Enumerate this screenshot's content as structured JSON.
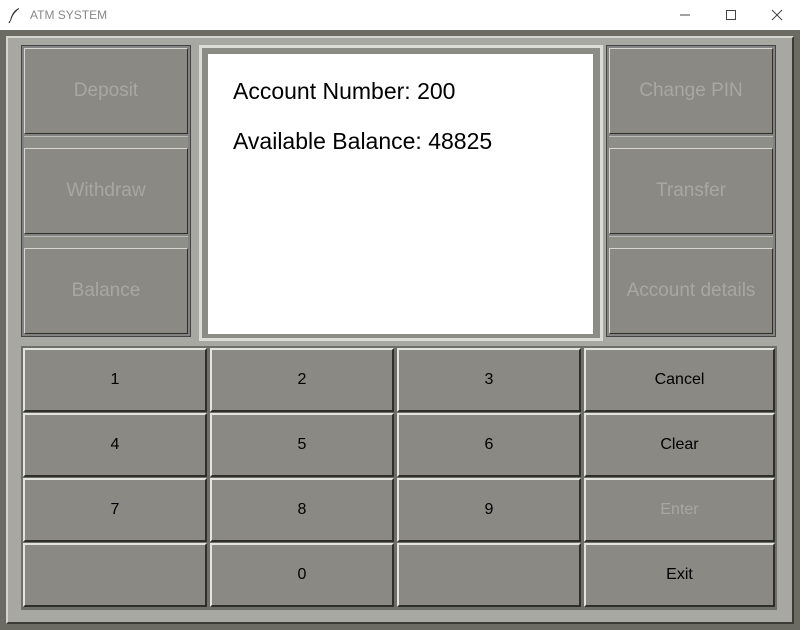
{
  "window": {
    "title": "ATM SYSTEM"
  },
  "icons": {
    "app": "feather-icon",
    "minimize": "minimize-icon",
    "maximize": "maximize-icon",
    "close": "close-icon"
  },
  "colors": {
    "frame": "#6b6b64",
    "button_face": "#8a8983",
    "disabled_text": "#a8a8a2",
    "screen": "#ffffff"
  },
  "left_buttons": [
    {
      "label": "Deposit",
      "enabled": false
    },
    {
      "label": "Withdraw",
      "enabled": false
    },
    {
      "label": "Balance",
      "enabled": false
    }
  ],
  "right_buttons": [
    {
      "label": "Change PIN",
      "enabled": false
    },
    {
      "label": "Transfer",
      "enabled": false
    },
    {
      "label": "Account details",
      "enabled": false
    }
  ],
  "display": {
    "account_line": "Account Number: 200",
    "balance_line": "Available Balance: 48825"
  },
  "keypad": {
    "rows": [
      [
        {
          "label": "1",
          "enabled": true
        },
        {
          "label": "2",
          "enabled": true
        },
        {
          "label": "3",
          "enabled": true
        },
        {
          "label": "Cancel",
          "enabled": true
        }
      ],
      [
        {
          "label": "4",
          "enabled": true
        },
        {
          "label": "5",
          "enabled": true
        },
        {
          "label": "6",
          "enabled": true
        },
        {
          "label": "Clear",
          "enabled": true
        }
      ],
      [
        {
          "label": "7",
          "enabled": true
        },
        {
          "label": "8",
          "enabled": true
        },
        {
          "label": "9",
          "enabled": true
        },
        {
          "label": "Enter",
          "enabled": false
        }
      ],
      [
        {
          "label": "",
          "enabled": true
        },
        {
          "label": "0",
          "enabled": true
        },
        {
          "label": "",
          "enabled": true
        },
        {
          "label": "Exit",
          "enabled": true
        }
      ]
    ]
  }
}
